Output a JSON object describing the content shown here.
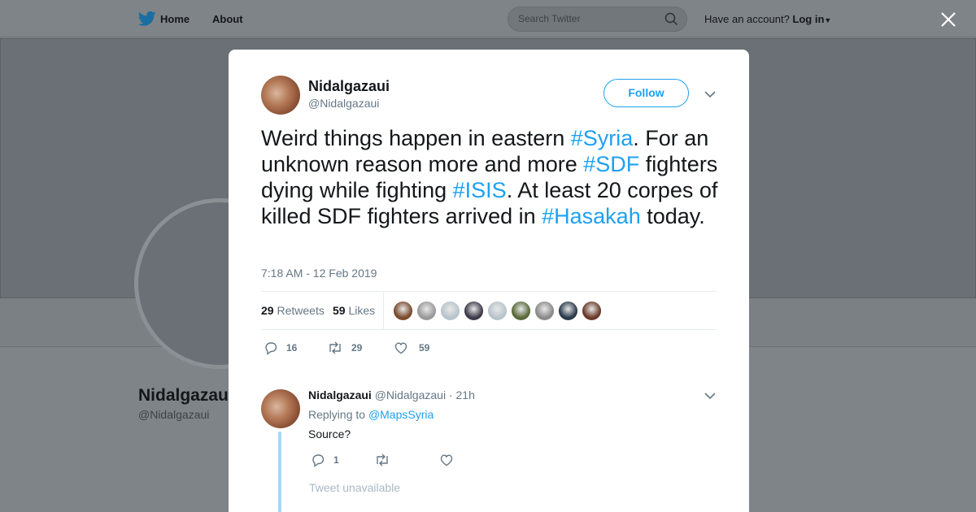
{
  "topbar": {
    "home_label": "Home",
    "about_label": "About",
    "search_placeholder": "Search Twitter",
    "account_prompt": "Have an account?",
    "login_label": "Log in"
  },
  "background_profile": {
    "name": "Nidalgazaui",
    "handle": "@Nidalgazaui"
  },
  "tweet": {
    "author_name": "Nidalgazaui",
    "author_handle": "@Nidalgazaui",
    "follow_label": "Follow",
    "text_parts": [
      {
        "text": "Weird things happen in eastern ",
        "tag": false
      },
      {
        "text": "#Syria",
        "tag": true
      },
      {
        "text": ". For an unknown reason more and more ",
        "tag": false
      },
      {
        "text": "#SDF",
        "tag": true
      },
      {
        "text": " fighters dying while fighting ",
        "tag": false
      },
      {
        "text": "#ISIS",
        "tag": true
      },
      {
        "text": ". At least 20 corpes of killed SDF fighters arrived in ",
        "tag": false
      },
      {
        "text": "#Hasakah",
        "tag": true
      },
      {
        "text": " today.",
        "tag": false
      }
    ],
    "timestamp": "7:18 AM - 12 Feb 2019",
    "retweets_count": "29",
    "retweets_label": "Retweets",
    "likes_count": "59",
    "likes_label": "Likes",
    "likers": [
      "#7a4a2c",
      "#9a9a9a",
      "#b8c4cc",
      "#3d3a4a",
      "#b8c4cc",
      "#5a6a3a",
      "#8a8a8a",
      "#2a3a4a",
      "#6a3a2a"
    ],
    "reply_count": "16",
    "retweet_count": "29",
    "like_count": "59"
  },
  "reply": {
    "author_name": "Nidalgazaui",
    "author_handle": "@Nidalgazaui",
    "time": "· 21h",
    "replying_to_label": "Replying to",
    "replying_to_mention": "@MapsSyria",
    "text": "Source?",
    "reply_count": "1",
    "unavailable_label": "Tweet unavailable"
  },
  "colors": {
    "accent": "#1da1f2",
    "overlay": "#7f8488"
  }
}
